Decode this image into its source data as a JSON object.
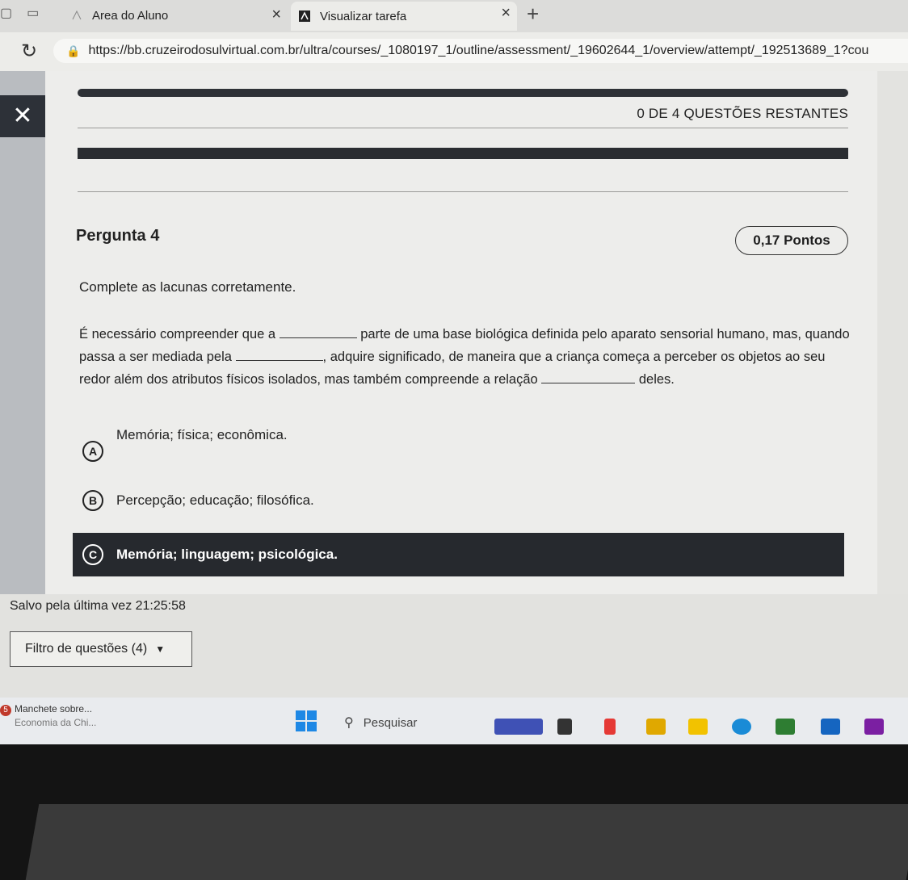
{
  "browser": {
    "tabs": [
      {
        "title": "Area do Aluno"
      },
      {
        "title": "Visualizar tarefa"
      }
    ],
    "url": "https://bb.cruzeirodosulvirtual.com.br/ultra/courses/_1080197_1/outline/assessment/_19602644_1/overview/attempt/_192513689_1?cou"
  },
  "assessment": {
    "remaining": "0 DE 4 QUESTÕES RESTANTES",
    "question_title": "Pergunta 4",
    "points": "0,17 Pontos",
    "instruction": "Complete as lacunas corretamente.",
    "text_parts": [
      "É necessário compreender que a ",
      " parte de uma base biológica definida pelo aparato sensorial humano, mas, quando passa a ser mediada pela ",
      ", adquire significado, de maneira que a criança começa a perceber os objetos ao seu redor além dos atributos físicos isolados, mas também compreende a relação ",
      " deles."
    ],
    "options": [
      {
        "letter": "A",
        "text": "Memória; física; econômica."
      },
      {
        "letter": "B",
        "text": "Percepção; educação; filosófica."
      },
      {
        "letter": "C",
        "text": "Memória; linguagem; psicológica.",
        "selected": true
      }
    ],
    "saved": "Salvo pela última vez 21:25:58",
    "filter": "Filtro de questões (4)"
  },
  "taskbar": {
    "news_badge": "5",
    "news_title": "Manchete sobre...",
    "news_sub": "Economia da Chi...",
    "search": "Pesquisar"
  },
  "colors": {
    "dark_bar": "#2a2d31",
    "selected_option": "#26292e",
    "windows_blue": "#1e88e5"
  }
}
